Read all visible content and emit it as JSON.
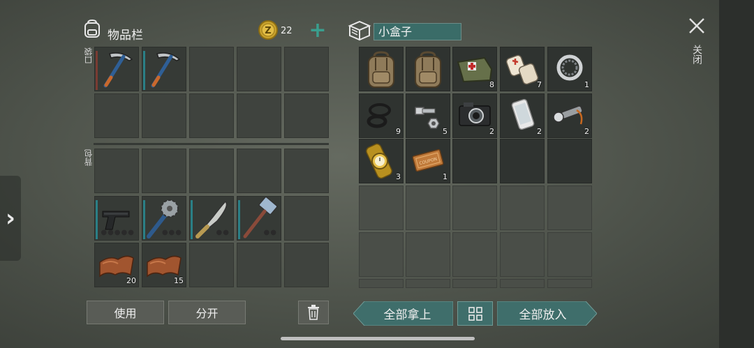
{
  "inventory": {
    "title": "物品栏",
    "coins": "22",
    "add_label": "+",
    "pocket_label": "口袋",
    "backpack_label": "背包",
    "pocket_slots": [
      {
        "item": "pickaxe-icon",
        "count": ""
      },
      {
        "item": "pickaxe-icon",
        "count": ""
      }
    ],
    "backpack_slots": [
      {
        "item": "pistol-icon",
        "count": ""
      },
      {
        "item": "saw-blade-mace-icon",
        "count": ""
      },
      {
        "item": "machete-icon",
        "count": ""
      },
      {
        "item": "sledgehammer-icon",
        "count": ""
      },
      {
        "item": "leather-icon",
        "count": "20"
      },
      {
        "item": "leather-icon",
        "count": "15"
      }
    ],
    "use_label": "使用",
    "split_label": "分开"
  },
  "box": {
    "name": "小盒子",
    "items": [
      {
        "item": "backpack-icon",
        "count": ""
      },
      {
        "item": "backpack-icon",
        "count": ""
      },
      {
        "item": "first-aid-bag-icon",
        "count": "8"
      },
      {
        "item": "bandage-icon",
        "count": "7"
      },
      {
        "item": "bearing-icon",
        "count": "1"
      },
      {
        "item": "rubber-rings-icon",
        "count": "9"
      },
      {
        "item": "bolt-nut-icon",
        "count": "5"
      },
      {
        "item": "camera-icon",
        "count": "2"
      },
      {
        "item": "smartphone-icon",
        "count": "2"
      },
      {
        "item": "flashlight-icon",
        "count": "2"
      },
      {
        "item": "gold-watch-icon",
        "count": "3"
      },
      {
        "item": "coupon-icon",
        "count": "1"
      }
    ],
    "take_all_label": "全部拿上",
    "put_all_label": "全部放入"
  },
  "close_label": "关闭",
  "colors": {
    "accent_teal": "#3f6e6b",
    "durability_teal": "#2a7f86"
  }
}
